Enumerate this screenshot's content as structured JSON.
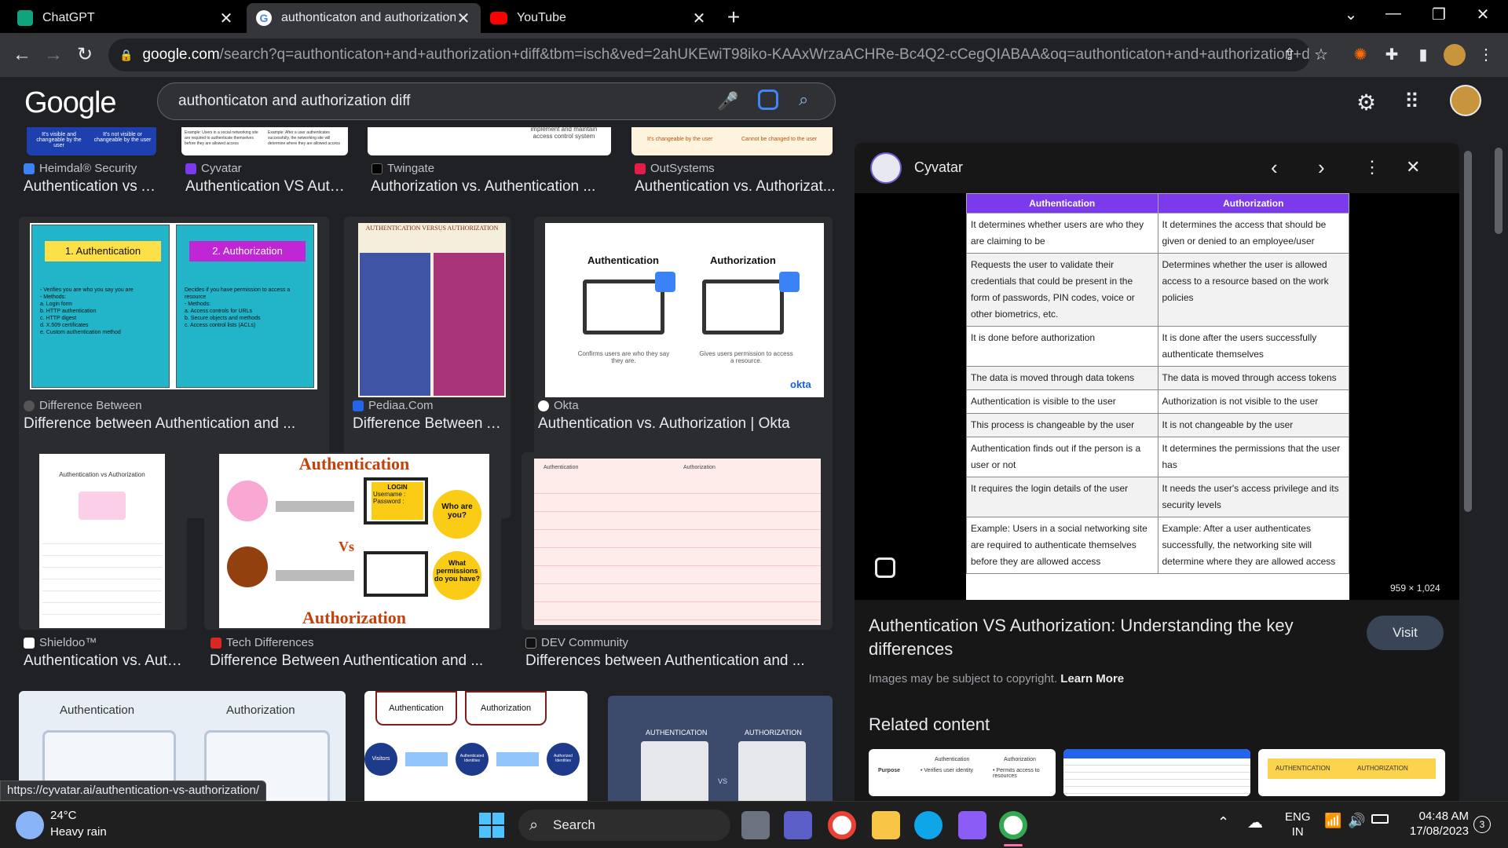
{
  "tabs": [
    {
      "title": "ChatGPT",
      "icon": "chatgpt-icon"
    },
    {
      "title": "authonticaton and authorization diff",
      "icon": "google-icon"
    },
    {
      "title": "YouTube",
      "icon": "youtube-icon"
    }
  ],
  "omnibox": {
    "domain": "google.com",
    "path": "/search?q=authonticaton+and+authorization+diff&tbm=isch&ved=2ahUKEwiT98iko-KAAxWrzaACHRe-Bc4Q2-cCegQIABAA&oq=authonticaton+and+authorization+diff&g..."
  },
  "google": {
    "logo": "Google",
    "query": "authonticaton and authorization diff"
  },
  "results": [
    {
      "source": "Heimdal® Security",
      "title": "Authentication vs A..."
    },
    {
      "source": "Cyvatar",
      "title": "Authentication VS Auth..."
    },
    {
      "source": "Twingate",
      "title": "Authorization vs. Authentication ..."
    },
    {
      "source": "OutSystems",
      "title": "Authentication vs. Authorizat..."
    },
    {
      "source": "Difference Between",
      "title": "Difference between Authentication and ..."
    },
    {
      "source": "Pediaa.Com",
      "title": "Difference Between Aut..."
    },
    {
      "source": "Okta",
      "title": "Authentication vs. Authorization | Okta"
    },
    {
      "source": "Shieldoo™",
      "title": "Authentication vs. Auth..."
    },
    {
      "source": "Tech Differences",
      "title": "Difference Between Authentication and ..."
    },
    {
      "source": "DEV Community",
      "title": "Differences between Authentication and ..."
    }
  ],
  "thumbs": {
    "top_blue_a": "It's visible and changeable by the user",
    "top_blue_b": "It's not visible or changeable by the user",
    "top_cyvatar_a": "Example: Users in a social networking site are required to authenticate themselves before they are allowed access",
    "top_cyvatar_b": "Example: After a user authenticates successfully, the networking site will determine where they are allowed access",
    "top_twingate": "implement and maintain access control system",
    "top_out_a": "It's changeable by the user",
    "top_out_b": "Cannot be changed to the user",
    "db_auth": "1. Authentication",
    "db_authz": "2. Authorization",
    "db_auth_body": "- Verifies you are who you say you are\n- Methods:\n  a. Login form\n  b. HTTP authentication\n  c. HTTP digest\n  d. X.509 certificates\n  e. Custom authentication method",
    "db_authz_body": "Decides if you have permission to access a resource\n- Methods:\n  a. Access controls for URLs\n  b. Secure objects and methods\n  c. Access control lists (ACLs)",
    "pediaa_title": "AUTHENTICATION VERSUS AUTHORIZATION",
    "okta_auth": "Authentication",
    "okta_authz": "Authorization",
    "okta_auth_sub": "Confirms users are who they say they are.",
    "okta_authz_sub": "Gives users permission to access a resource.",
    "okta_logo": "okta",
    "shield_title": "Authentication vs Authorization",
    "td_auth": "Authentication",
    "td_authz": "Authorization",
    "td_vs": "Vs",
    "td_login": "LOGIN",
    "td_user": "Username :",
    "td_pass": "Password :",
    "td_who": "Who are you?",
    "td_what": "What permissions do you have?",
    "dev_h1": "Authentication",
    "dev_h2": "Authorization",
    "b_auth": "Authentication",
    "b_authz": "Authorization",
    "c_auth": "Authentication",
    "c_authz": "Authorization",
    "c_visitors": "Visitors",
    "c_auth_id": "Authenticated Identities",
    "c_authz_id": "Authorized Identities",
    "d_auth": "AUTHENTICATION",
    "d_authz": "AUTHORIZATION",
    "d_vs": "VS"
  },
  "panel": {
    "site": "Cyvatar",
    "header_auth": "Authentication",
    "header_authz": "Authorization",
    "rows": [
      [
        "It determines whether users are who they are claiming to be",
        "It determines the access that should be given or denied to an employee/user"
      ],
      [
        "Requests the user to validate their credentials that could be present in the form of passwords, PIN codes, voice or other biometrics, etc.",
        "Determines whether the user is allowed access to a resource based on the work policies"
      ],
      [
        "It is done before authorization",
        "It is done after the users successfully authenticate themselves"
      ],
      [
        "The data is moved through data tokens",
        "The data is moved through access tokens"
      ],
      [
        "Authentication is visible to the user",
        "Authorization is not visible to the user"
      ],
      [
        "This process is changeable by the user",
        "It is not changeable by the user"
      ],
      [
        "Authentication finds out if the person is a user or not",
        "It determines the permissions that the user has"
      ],
      [
        "It requires the login details of the user",
        "It needs the user's access privilege and its security levels"
      ],
      [
        "Example: Users in a social networking site are required to authenticate themselves before they are allowed access",
        "Example: After a user authenticates successfully, the networking site will determine where they are allowed access"
      ]
    ],
    "dimensions": "959 × 1,024",
    "title": "Authentication VS Authorization: Understanding the key differences",
    "visit": "Visit",
    "copyright": "Images may be subject to copyright.",
    "learn_more": "Learn More",
    "related": "Related content",
    "rel1_a": "Authentication",
    "rel1_b": "Authorization",
    "rel1_row": "Purpose",
    "rel1_c1": "• Verifies user identity",
    "rel1_c2": "• Permits access to resources",
    "rel3_a": "AUTHENTICATION",
    "rel3_b": "AUTHORIZATION"
  },
  "status_url": "https://cyvatar.ai/authentication-vs-authorization/",
  "taskbar": {
    "temp": "24°C",
    "weather": "Heavy rain",
    "search": "Search",
    "lang1": "ENG",
    "lang2": "IN",
    "time": "04:48 AM",
    "date": "17/08/2023",
    "notif": "3"
  },
  "colors": {
    "accent_purple": "#7c3aed",
    "chrome_dark": "#35363a",
    "page_bg": "#202124"
  }
}
